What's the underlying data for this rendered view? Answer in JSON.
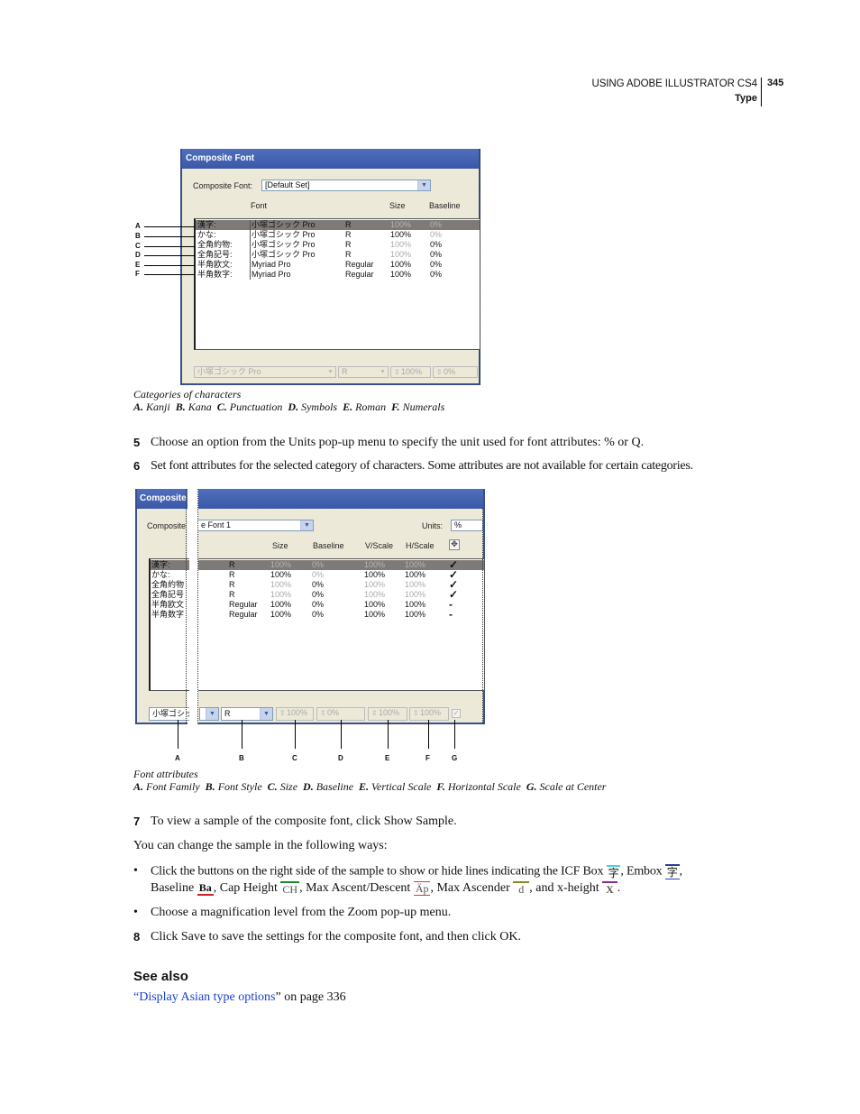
{
  "header": {
    "doc_title": "USING ADOBE ILLUSTRATOR CS4",
    "section": "Type",
    "page_number": "345"
  },
  "figure1": {
    "dialog_title": "Composite Font",
    "composite_font_label": "Composite Font:",
    "composite_font_value": "[Default Set]",
    "columns": {
      "font": "Font",
      "size": "Size",
      "baseline": "Baseline"
    },
    "rows": [
      {
        "category": "漢字:",
        "font": "小塚ゴシック Pro",
        "style": "R",
        "size": "100%",
        "baseline": "0%",
        "selected": true
      },
      {
        "category": "かな:",
        "font": "小塚ゴシック Pro",
        "style": "R",
        "size": "100%",
        "baseline": "0%"
      },
      {
        "category": "全角約物:",
        "font": "小塚ゴシック Pro",
        "style": "R",
        "size": "100%",
        "baseline": "0%"
      },
      {
        "category": "全角記号:",
        "font": "小塚ゴシック Pro",
        "style": "R",
        "size": "100%",
        "baseline": "0%"
      },
      {
        "category": "半角欧文:",
        "font": "Myriad Pro",
        "style": "Regular",
        "size": "100%",
        "baseline": "0%"
      },
      {
        "category": "半角数字:",
        "font": "Myriad Pro",
        "style": "Regular",
        "size": "100%",
        "baseline": "0%"
      }
    ],
    "bottom_controls": {
      "font_family": "小塚ゴシック Pro",
      "font_style": "R",
      "size": "100%",
      "baseline": "0%"
    },
    "callout_letters": [
      "A",
      "B",
      "C",
      "D",
      "E",
      "F"
    ],
    "caption_title": "Categories of characters",
    "caption_items": [
      {
        "letter": "A.",
        "text": "Kanji"
      },
      {
        "letter": "B.",
        "text": "Kana"
      },
      {
        "letter": "C.",
        "text": "Punctuation"
      },
      {
        "letter": "D.",
        "text": "Symbols"
      },
      {
        "letter": "E.",
        "text": "Roman"
      },
      {
        "letter": "F.",
        "text": "Numerals"
      }
    ]
  },
  "steps_a": [
    {
      "num": "5",
      "text": "Choose an option from the Units pop-up menu to specify the unit used for font attributes: % or Q."
    },
    {
      "num": "6",
      "text": "Set font attributes for the selected category of characters. Some attributes are not available for certain categories."
    }
  ],
  "figure2": {
    "dialog_title": "Composite",
    "composite_font_label": "Composite",
    "composite_font_value": "e Font 1",
    "units_label": "Units:",
    "units_value": "%",
    "columns": {
      "size": "Size",
      "baseline": "Baseline",
      "vscale": "V/Scale",
      "hscale": "H/Scale"
    },
    "scale_icon": "scale-at-center-icon",
    "rows": [
      {
        "category": "漢字:",
        "style": "R",
        "size": "100%",
        "baseline": "0%",
        "vscale": "100%",
        "hscale": "100%",
        "center": "✓",
        "selected": true
      },
      {
        "category": "かな:",
        "style": "R",
        "size": "100%",
        "baseline": "0%",
        "vscale": "100%",
        "hscale": "100%",
        "center": "✓"
      },
      {
        "category": "全角約物",
        "style": "R",
        "size": "100%",
        "baseline": "0%",
        "vscale": "100%",
        "hscale": "100%",
        "center": "✓"
      },
      {
        "category": "全角記号",
        "style": "R",
        "size": "100%",
        "baseline": "0%",
        "vscale": "100%",
        "hscale": "100%",
        "center": "✓"
      },
      {
        "category": "半角欧文",
        "style": "Regular",
        "size": "100%",
        "baseline": "0%",
        "vscale": "100%",
        "hscale": "100%",
        "center": "-"
      },
      {
        "category": "半角数字",
        "style": "Regular",
        "size": "100%",
        "baseline": "0%",
        "vscale": "100%",
        "hscale": "100%",
        "center": "-"
      }
    ],
    "bottom_controls": {
      "font_family": "小塚ゴシッ",
      "font_style": "R",
      "size": "100%",
      "baseline": "0%",
      "vscale": "100%",
      "hscale": "100%",
      "center_checked": true
    },
    "callout_letters": [
      "A",
      "B",
      "C",
      "D",
      "E",
      "F",
      "G"
    ],
    "caption_title": "Font attributes",
    "caption_items": [
      {
        "letter": "A.",
        "text": "Font Family"
      },
      {
        "letter": "B.",
        "text": "Font Style"
      },
      {
        "letter": "C.",
        "text": "Size"
      },
      {
        "letter": "D.",
        "text": "Baseline"
      },
      {
        "letter": "E.",
        "text": "Vertical Scale"
      },
      {
        "letter": "F.",
        "text": "Horizontal Scale"
      },
      {
        "letter": "G.",
        "text": "Scale at Center"
      }
    ]
  },
  "step7": {
    "num": "7",
    "text": "To view a sample of the composite font, click Show Sample."
  },
  "sample_intro": "You can change the sample in the following ways:",
  "bullets": {
    "b1_part1": "Click the buttons on the right side of the sample to show or hide lines indicating the ICF Box",
    "b1_icf_glyph": "字",
    "b1_part2": ", Embox",
    "b1_embox_glyph": "字",
    "b1_part3": ",",
    "b1_line2_baseline": "Baseline",
    "b1_baseline_glyph": "Ba",
    "b1_capheight": ", Cap Height",
    "b1_capheight_glyph": "CH",
    "b1_maxad": ", Max Ascent/Descent",
    "b1_maxad_glyph": "Äp",
    "b1_maxasc": ", Max Ascender",
    "b1_maxasc_glyph": "d",
    "b1_xheight": ", and x-height",
    "b1_xheight_glyph": "X",
    "b1_end": ".",
    "b2": "Choose a magnification level from the Zoom pop-up menu.",
    "bullet_char": "•"
  },
  "step8": {
    "num": "8",
    "text": "Click Save to save the settings for the composite font, and then click OK."
  },
  "see_also": {
    "heading": "See also",
    "open_quote": "“",
    "link_text": "Display Asian type options",
    "close_quote": "”",
    "suffix": " on page 336"
  },
  "colors": {
    "icf_box": "#3fd6e8",
    "embox": "#2a3f9a",
    "baseline": "#d02020",
    "cap_height": "#1a8a2a",
    "max_ascent_descent": "#e03a2a",
    "max_ascender": "#8a8a1a",
    "x_height": "#8a2a8a",
    "link": "#1a3fd1",
    "dialog_title": "#3b58a8"
  }
}
